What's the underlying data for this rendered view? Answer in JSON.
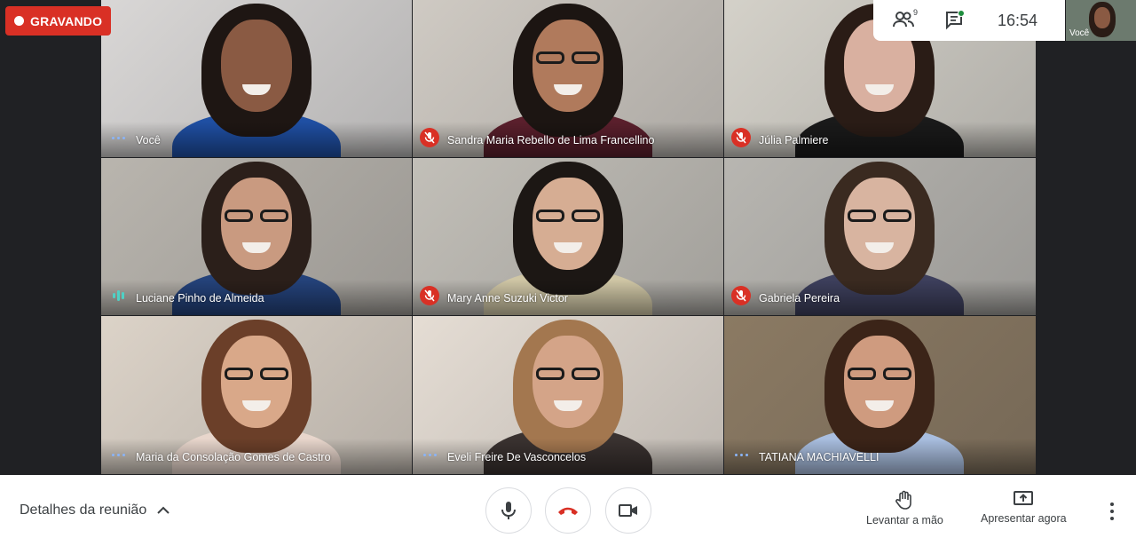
{
  "recording": {
    "label": "GRAVANDO"
  },
  "topbar": {
    "participants_count": "9",
    "time": "16:54",
    "self_label": "Você"
  },
  "tiles": [
    {
      "name": "Você",
      "status": "speaking-dots",
      "bg": "#d9d7d6",
      "hair": "#1e1613",
      "skin": "#8a5a43",
      "shirt": "#1f4fa3",
      "glasses": false
    },
    {
      "name": "Sandra Maria Rebello de Lima Francellino",
      "status": "muted",
      "bg": "#cfcac3",
      "hair": "#1c1512",
      "skin": "#b07a5c",
      "shirt": "#5a1f2c",
      "glasses": true
    },
    {
      "name": "Júlia Palmiere",
      "status": "muted",
      "bg": "#d4d1c9",
      "hair": "#2a1c16",
      "skin": "#d9b0a0",
      "shirt": "#1a1a1a",
      "glasses": false
    },
    {
      "name": "Luciane Pinho de Almeida",
      "status": "speaking-bars",
      "bg": "#b9b5ae",
      "hair": "#2b1f1a",
      "skin": "#c99a80",
      "shirt": "#24427a",
      "glasses": true
    },
    {
      "name": "Mary Anne Suzuki Victor",
      "status": "muted",
      "bg": "#c2bfb8",
      "hair": "#1c1714",
      "skin": "#d6ad93",
      "shirt": "#cfc6a5",
      "glasses": true
    },
    {
      "name": "Gabriela Pereira",
      "status": "muted",
      "bg": "#b8b6b1",
      "hair": "#3a2a20",
      "skin": "#d8b4a0",
      "shirt": "#3d3f5c",
      "glasses": true
    },
    {
      "name": "Maria da Consolação Gomes de Castro",
      "status": "speaking-dots",
      "bg": "#dcd3c8",
      "hair": "#6b3f29",
      "skin": "#d9a889",
      "shirt": "#e8d6cc",
      "glasses": true
    },
    {
      "name": "Eveli Freire De Vasconcelos",
      "status": "speaking-dots",
      "bg": "#e5ddd4",
      "hair": "#a3774f",
      "skin": "#d4a488",
      "shirt": "#3a3230",
      "glasses": true
    },
    {
      "name": "TATIANA MACHIAVELLI",
      "status": "speaking-dots",
      "bg": "#8b7a63",
      "hair": "#3b2418",
      "skin": "#cf9b7f",
      "shirt": "#a9bedf",
      "glasses": true
    }
  ],
  "bottombar": {
    "details_label": "Detalhes da reunião",
    "raise_hand_label": "Levantar a mão",
    "present_label": "Apresentar agora"
  },
  "colors": {
    "accent_red": "#d93025",
    "teal": "#4fd1c5",
    "bar_text": "#3c4043"
  }
}
